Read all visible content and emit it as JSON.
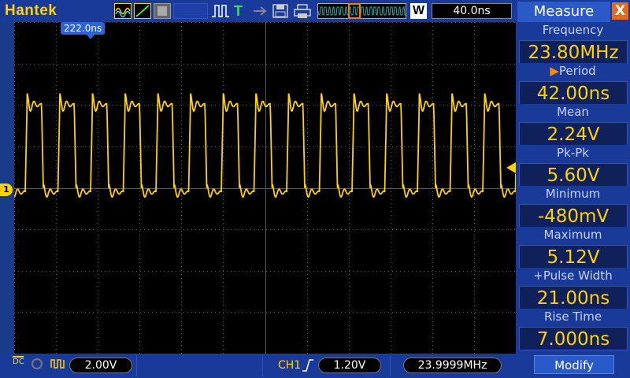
{
  "toolbar": {
    "brand": "Hantek",
    "memory_badge": "W",
    "timebase": "40.0ns",
    "icons": [
      "wave-mode-icon",
      "line-mode-icon",
      "persist-icon",
      "pulse-icon",
      "trigger-T-icon",
      "arrow-icon",
      "save-disk-icon",
      "print-icon"
    ]
  },
  "scope": {
    "trigger_position": "222.0ns",
    "channel_marker": "1",
    "trace_color": "#ffd200",
    "grid_color": "#5a5a5a"
  },
  "bottom": {
    "coupling": "DC",
    "ch1_volt_div": "2.00V",
    "trigger_channel": "CH1",
    "trigger_level": "1.20V",
    "counter_freq": "23.9999MHz"
  },
  "measure": {
    "title": "Measure",
    "close": "X",
    "items": [
      {
        "label": "Frequency",
        "value": "23.80MHz"
      },
      {
        "label": "Period",
        "value": "42.00ns",
        "selected_marker": "▶"
      },
      {
        "label": "Mean",
        "value": "2.24V"
      },
      {
        "label": "Pk-Pk",
        "value": "5.60V"
      },
      {
        "label": "Minimum",
        "value": "-480mV"
      },
      {
        "label": "Maximum",
        "value": "5.12V"
      },
      {
        "label": "+Pulse Width",
        "value": "21.00ns"
      },
      {
        "label": "Rise Time",
        "value": "7.000ns"
      }
    ],
    "modify": "Modify"
  }
}
